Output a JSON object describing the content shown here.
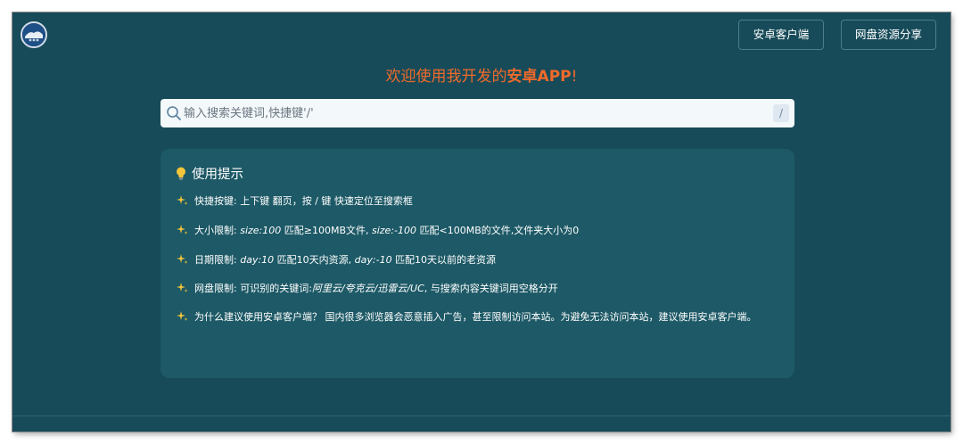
{
  "header": {
    "logo_icon": "app-logo-icon",
    "buttons": {
      "android_client": "安卓客户端",
      "netdisk_share": "网盘资源分享"
    }
  },
  "welcome": {
    "prefix": "欢迎使用我开发的",
    "highlight": "安卓APP",
    "suffix": "!"
  },
  "search": {
    "placeholder": "输入搜索关键词,快捷键'/'",
    "value": "",
    "shortcut": "/"
  },
  "tips": {
    "title": "使用提示",
    "items": [
      {
        "label": "快捷按键:",
        "text": " 上下键 翻页，按 / 键 快速定位至搜索框"
      },
      {
        "label": "大小限制:",
        "ex1": "size:100",
        "mid1": " 匹配≥100MB文件,",
        "ex2": "size:-100",
        "mid2": " 匹配<100MB的文件,文件夹大小为0"
      },
      {
        "label": "日期限制:",
        "ex1": "day:10",
        "mid1": " 匹配10天内资源,",
        "ex2": "day:-10",
        "mid2": " 匹配10天以前的老资源"
      },
      {
        "label": "网盘限制:",
        "text": " 可识别的关键词:",
        "ex1": "阿里云/夸克云/迅雷云/UC",
        "mid1": ", 与搜索内容关键词用空格分开"
      },
      {
        "text": "为什么建议使用安卓客户端？ 国内很多浏览器会恶意插入广告，甚至限制访问本站。为避免无法访问本站，建议使用安卓客户端。"
      }
    ]
  },
  "colors": {
    "background": "#174b59",
    "card": "#1d5966",
    "accent": "#f06a2a"
  }
}
